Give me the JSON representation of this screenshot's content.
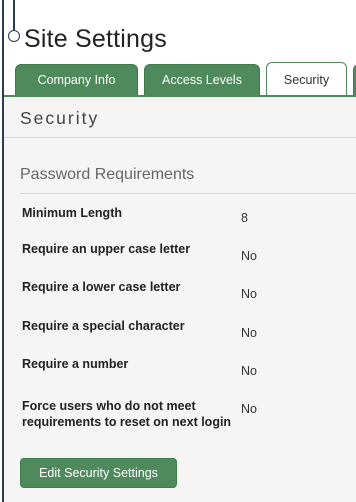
{
  "page": {
    "title": "Site Settings"
  },
  "tabs": [
    {
      "label": "Company Info"
    },
    {
      "label": "Access Levels"
    },
    {
      "label": "Security"
    }
  ],
  "panel": {
    "heading": "Security",
    "section_title": "Password Requirements",
    "rows": [
      {
        "label": "Minimum Length",
        "value": "8"
      },
      {
        "label": "Require an upper case letter",
        "value": "No"
      },
      {
        "label": "Require a lower case letter",
        "value": "No"
      },
      {
        "label": "Require a special character",
        "value": "No"
      },
      {
        "label": "Require a number",
        "value": "No"
      },
      {
        "label": "Force users who do not meet requirements to reset on next login",
        "value": "No"
      }
    ],
    "edit_button_label": "Edit Security Settings"
  },
  "colors": {
    "accent": "#4e8a5b",
    "frame": "#2b3a55"
  }
}
